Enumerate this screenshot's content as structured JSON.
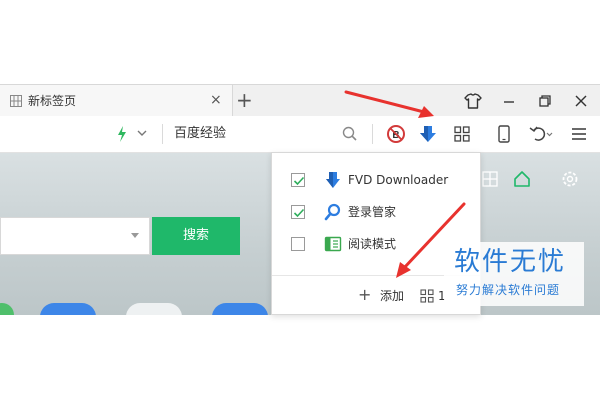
{
  "tab": {
    "title": "新标签页",
    "close": "×"
  },
  "new_tab_glyph": "+",
  "address_bar": {
    "text": "百度经验"
  },
  "content": {
    "search_button": "搜索"
  },
  "extensions_panel": {
    "items": [
      {
        "label": "FVD Downloader",
        "checked": true,
        "icon": "fvd-downloader-icon"
      },
      {
        "label": "登录管家",
        "checked": true,
        "icon": "login-manager-icon"
      },
      {
        "label": "阅读模式",
        "checked": false,
        "icon": "reading-mode-icon"
      }
    ],
    "add_glyph": "+",
    "add_label": "添加",
    "footer_count": "1"
  },
  "watermark": {
    "title": "软件无忧",
    "subtitle": "努力解决软件问题"
  },
  "colors": {
    "accent_green": "#1fb86a",
    "annotation_red": "#e8322e",
    "watermark_blue": "#2a7bd4",
    "download_blue": "#2d7de0"
  }
}
